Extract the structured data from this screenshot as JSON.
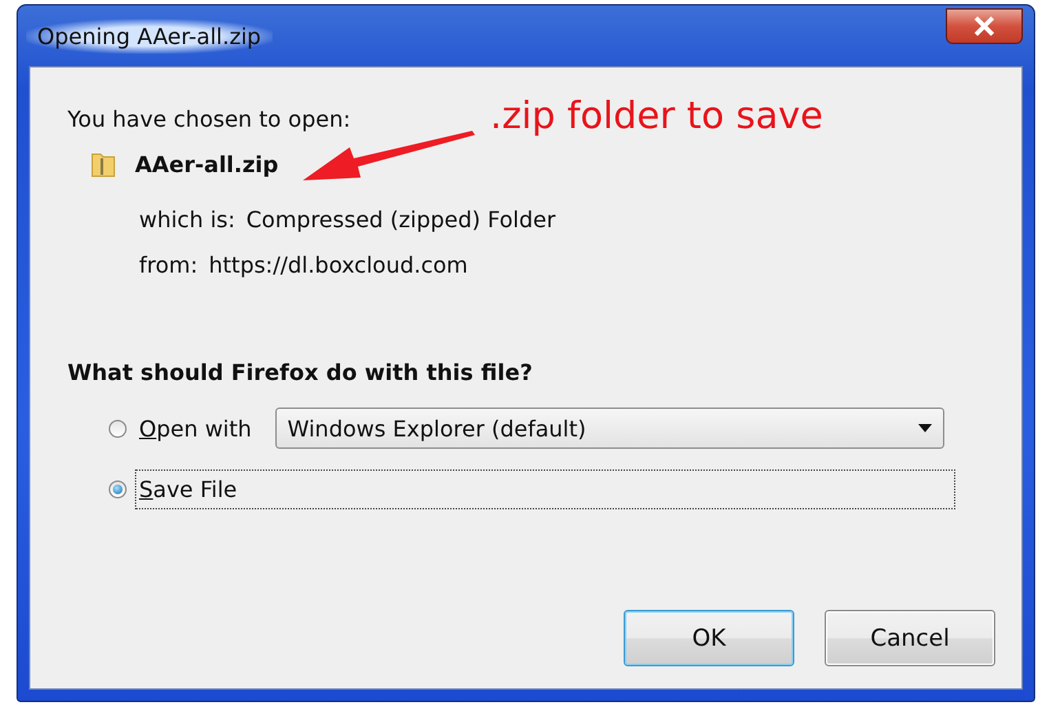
{
  "window": {
    "title": "Opening AAer-all.zip"
  },
  "intro": "You have chosen to open:",
  "file": {
    "name": "AAer-all.zip",
    "type_label": "which is:",
    "type": "Compressed (zipped) Folder",
    "from_label": "from:",
    "from": "https://dl.boxcloud.com"
  },
  "annotation": {
    "text": ".zip folder to save"
  },
  "question": "What should Firefox do with this file?",
  "options": [
    {
      "kind": "dropdown",
      "label": "Open with",
      "selected": false,
      "value": "Windows Explorer (default)"
    },
    {
      "kind": "plain",
      "label": "Save File",
      "selected": true
    }
  ],
  "buttons": [
    {
      "label": "OK",
      "default": true
    },
    {
      "label": "Cancel",
      "default": false
    }
  ]
}
